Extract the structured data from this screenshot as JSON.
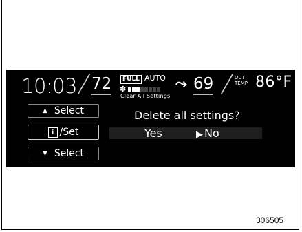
{
  "status_bar": {
    "clock": "10:03",
    "driver_temp": "72",
    "full_label": "FULL",
    "auto_label": "AUTO",
    "fan_level_filled": 3,
    "fan_level_total": 8,
    "screen_title": "Clear All Settings",
    "passenger_temp": "69",
    "out_label_line1": "OUT",
    "out_label_line2": "TEMP",
    "outside_temp": "86°F"
  },
  "controls": {
    "up_select_label": "Select",
    "info_set_label": "/Set",
    "info_icon_glyph": "i",
    "down_select_label": "Select"
  },
  "dialog": {
    "question": "Delete all settings?",
    "yes_label": "Yes",
    "no_label": "No"
  },
  "figure_id": "306505"
}
